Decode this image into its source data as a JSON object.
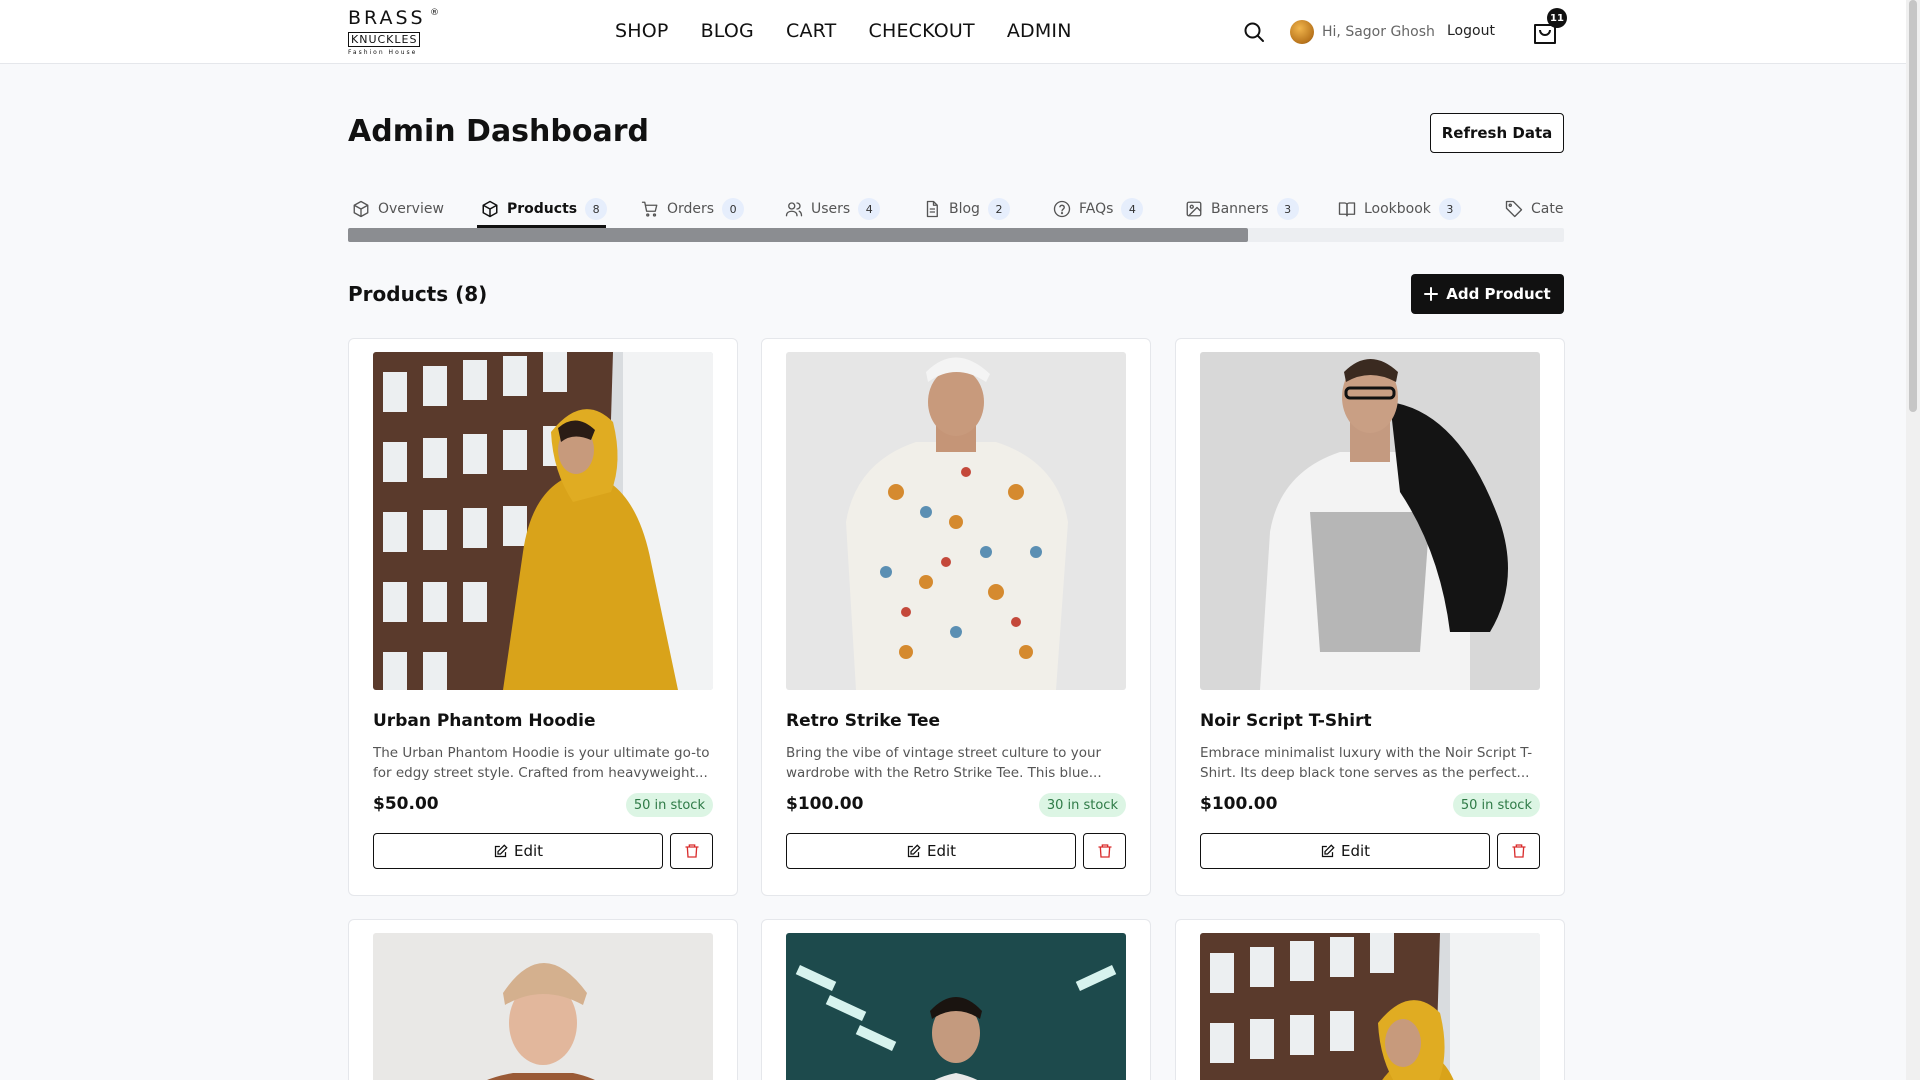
{
  "brand": {
    "line1": "BRASS",
    "line2": "KNUCKLES",
    "line3": "Fashion House",
    "registered": "®"
  },
  "nav": [
    "SHOP",
    "BLOG",
    "CART",
    "CHECKOUT",
    "ADMIN"
  ],
  "user": {
    "greeting": "Hi, Sagor Ghosh",
    "logout_label": "Logout",
    "cart_count": "11"
  },
  "dashboard": {
    "title": "Admin Dashboard",
    "refresh_label": "Refresh Data"
  },
  "tabs": [
    {
      "label": "Overview",
      "count": null,
      "icon": "package-icon"
    },
    {
      "label": "Products",
      "count": "8",
      "icon": "package-icon",
      "active": true
    },
    {
      "label": "Orders",
      "count": "0",
      "icon": "cart-icon"
    },
    {
      "label": "Users",
      "count": "4",
      "icon": "users-icon"
    },
    {
      "label": "Blog",
      "count": "2",
      "icon": "document-icon"
    },
    {
      "label": "FAQs",
      "count": "4",
      "icon": "help-icon"
    },
    {
      "label": "Banners",
      "count": "3",
      "icon": "image-icon"
    },
    {
      "label": "Lookbook",
      "count": "3",
      "icon": "book-icon"
    },
    {
      "label": "Cate",
      "count": null,
      "icon": "tag-icon"
    }
  ],
  "tab_scroll_progress": 0.74,
  "products_section": {
    "title": "Products (8)",
    "add_label": "Add Product"
  },
  "products": [
    {
      "name": "Urban Phantom Hoodie",
      "description": "The Urban Phantom Hoodie is your ultimate go-to for edgy street style. Crafted from heavyweight...",
      "price": "$50.00",
      "stock": "50 in stock",
      "edit_label": "Edit"
    },
    {
      "name": "Retro Strike Tee",
      "description": "Bring the vibe of vintage street culture to your wardrobe with the Retro Strike Tee. This blue...",
      "price": "$100.00",
      "stock": "30 in stock",
      "edit_label": "Edit"
    },
    {
      "name": "Noir Script T-Shirt",
      "description": "Embrace minimalist luxury with the Noir Script T-Shirt. Its deep black tone serves as the perfect...",
      "price": "$100.00",
      "stock": "50 in stock",
      "edit_label": "Edit"
    }
  ],
  "colors": {
    "accent": "#111111",
    "stock_bg": "#dcf5e4",
    "stock_text": "#2e7a46",
    "count_bg": "#e6eefc",
    "delete": "#d92d2d"
  }
}
